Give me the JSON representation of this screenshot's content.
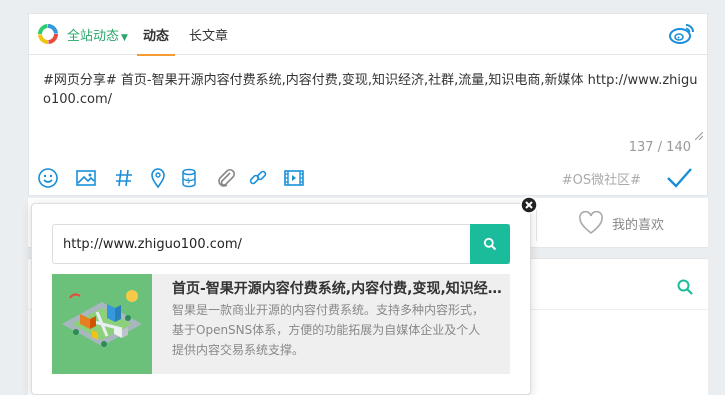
{
  "composer": {
    "scope_label": "全站动态",
    "tabs": [
      {
        "label": "动态"
      },
      {
        "label": "长文章"
      }
    ],
    "text": " #网页分享# 首页-智果开源内容付费系统,内容付费,变现,知识经济,社群,流量,知识电商,新媒体 http://www.zhiguo100.com/",
    "counter": "137 / 140",
    "topic_tag": "#OS微社区#",
    "toolbar_icons": [
      "smile-icon",
      "image-icon",
      "hashtag-icon",
      "location-icon",
      "coins-icon",
      "attachment-icon",
      "link-icon",
      "video-icon"
    ]
  },
  "likes": {
    "label": "我的喜欢"
  },
  "link_popup": {
    "url_value": "http://www.zhiguo100.com/",
    "card": {
      "title": "首页-智果开源内容付费系统,内容付费,变现,知识经济,社群,流量,知识电商,新媒体",
      "description": "智果是一款商业开源的内容付费系统。支持多种内容形式，基于OpenSNS体系，方便的功能拓展为自媒体企业及个人提供内容交易系统支撑。"
    }
  },
  "colors": {
    "accent": "#2aa66b",
    "brand_blue": "#1a8fd8",
    "button": "#1bbc9b",
    "tab_underline": "#f39c32"
  }
}
